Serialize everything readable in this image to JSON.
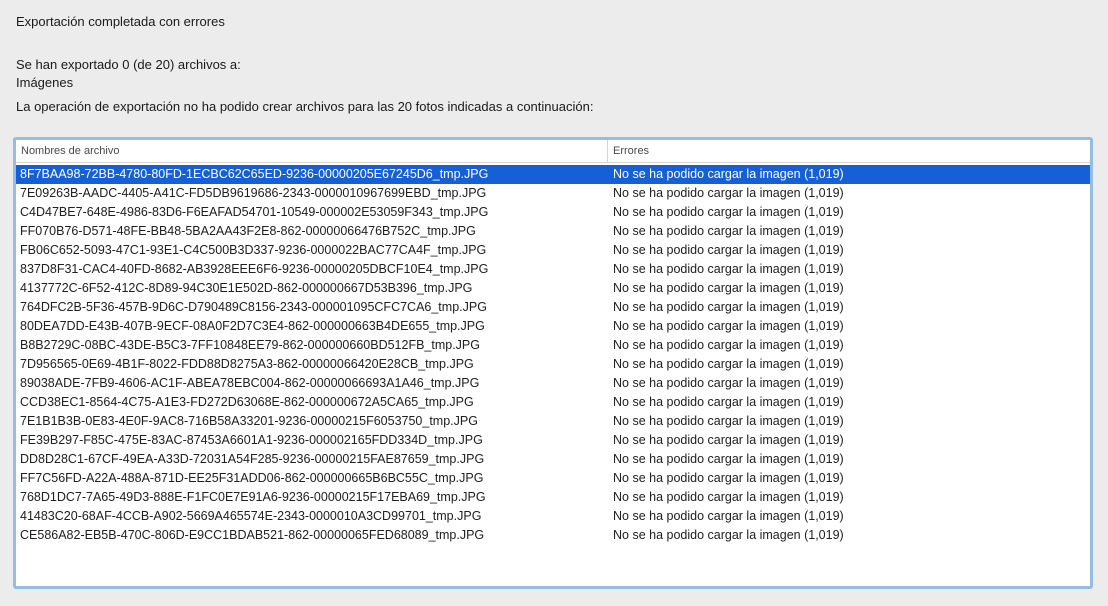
{
  "dialog": {
    "title": "Exportación completada con errores",
    "summary": "Se han exportado 0 (de 20) archivos a:",
    "destination": "Imágenes",
    "explanation": "La operación de exportación no ha podido crear archivos para las 20 fotos indicadas a continuación:"
  },
  "table": {
    "headers": {
      "file": "Nombres de archivo",
      "error": "Errores"
    },
    "selected_index": 0,
    "selection_color": "#1560d6",
    "rows": [
      {
        "file": "8F7BAA98-72BB-4780-80FD-1ECBC62C65ED-9236-00000205E67245D6_tmp.JPG",
        "error": "No se ha podido cargar la imagen (1,019)"
      },
      {
        "file": "7E09263B-AADC-4405-A41C-FD5DB9619686-2343-0000010967699EBD_tmp.JPG",
        "error": "No se ha podido cargar la imagen (1,019)"
      },
      {
        "file": "C4D47BE7-648E-4986-83D6-F6EAFAD54701-10549-000002E53059F343_tmp.JPG",
        "error": "No se ha podido cargar la imagen (1,019)"
      },
      {
        "file": "FF070B76-D571-48FE-BB48-5BA2AA43F2E8-862-00000066476B752C_tmp.JPG",
        "error": "No se ha podido cargar la imagen (1,019)"
      },
      {
        "file": "FB06C652-5093-47C1-93E1-C4C500B3D337-9236-0000022BAC77CA4F_tmp.JPG",
        "error": "No se ha podido cargar la imagen (1,019)"
      },
      {
        "file": "837D8F31-CAC4-40FD-8682-AB3928EEE6F6-9236-00000205DBCF10E4_tmp.JPG",
        "error": "No se ha podido cargar la imagen (1,019)"
      },
      {
        "file": "4137772C-6F52-412C-8D89-94C30E1E502D-862-000000667D53B396_tmp.JPG",
        "error": "No se ha podido cargar la imagen (1,019)"
      },
      {
        "file": "764DFC2B-5F36-457B-9D6C-D790489C8156-2343-000001095CFC7CA6_tmp.JPG",
        "error": "No se ha podido cargar la imagen (1,019)"
      },
      {
        "file": "80DEA7DD-E43B-407B-9ECF-08A0F2D7C3E4-862-000000663B4DE655_tmp.JPG",
        "error": "No se ha podido cargar la imagen (1,019)"
      },
      {
        "file": "B8B2729C-08BC-43DE-B5C3-7FF10848EE79-862-000000660BD512FB_tmp.JPG",
        "error": "No se ha podido cargar la imagen (1,019)"
      },
      {
        "file": "7D956565-0E69-4B1F-8022-FDD88D8275A3-862-00000066420E28CB_tmp.JPG",
        "error": "No se ha podido cargar la imagen (1,019)"
      },
      {
        "file": "89038ADE-7FB9-4606-AC1F-ABEA78EBC004-862-00000066693A1A46_tmp.JPG",
        "error": "No se ha podido cargar la imagen (1,019)"
      },
      {
        "file": "CCD38EC1-8564-4C75-A1E3-FD272D63068E-862-000000672A5CA65_tmp.JPG",
        "error": "No se ha podido cargar la imagen (1,019)"
      },
      {
        "file": "7E1B1B3B-0E83-4E0F-9AC8-716B58A33201-9236-00000215F6053750_tmp.JPG",
        "error": "No se ha podido cargar la imagen (1,019)"
      },
      {
        "file": "FE39B297-F85C-475E-83AC-87453A6601A1-9236-000002165FDD334D_tmp.JPG",
        "error": "No se ha podido cargar la imagen (1,019)"
      },
      {
        "file": "DD8D28C1-67CF-49EA-A33D-72031A54F285-9236-00000215FAE87659_tmp.JPG",
        "error": "No se ha podido cargar la imagen (1,019)"
      },
      {
        "file": "FF7C56FD-A22A-488A-871D-EE25F31ADD06-862-000000665B6BC55C_tmp.JPG",
        "error": "No se ha podido cargar la imagen (1,019)"
      },
      {
        "file": "768D1DC7-7A65-49D3-888E-F1FC0E7E91A6-9236-00000215F17EBA69_tmp.JPG",
        "error": "No se ha podido cargar la imagen (1,019)"
      },
      {
        "file": "41483C20-68AF-4CCB-A902-5669A465574E-2343-0000010A3CD99701_tmp.JPG",
        "error": "No se ha podido cargar la imagen (1,019)"
      },
      {
        "file": "CE586A82-EB5B-470C-806D-E9CC1BDAB521-862-00000065FED68089_tmp.JPG",
        "error": "No se ha podido cargar la imagen (1,019)"
      }
    ]
  }
}
